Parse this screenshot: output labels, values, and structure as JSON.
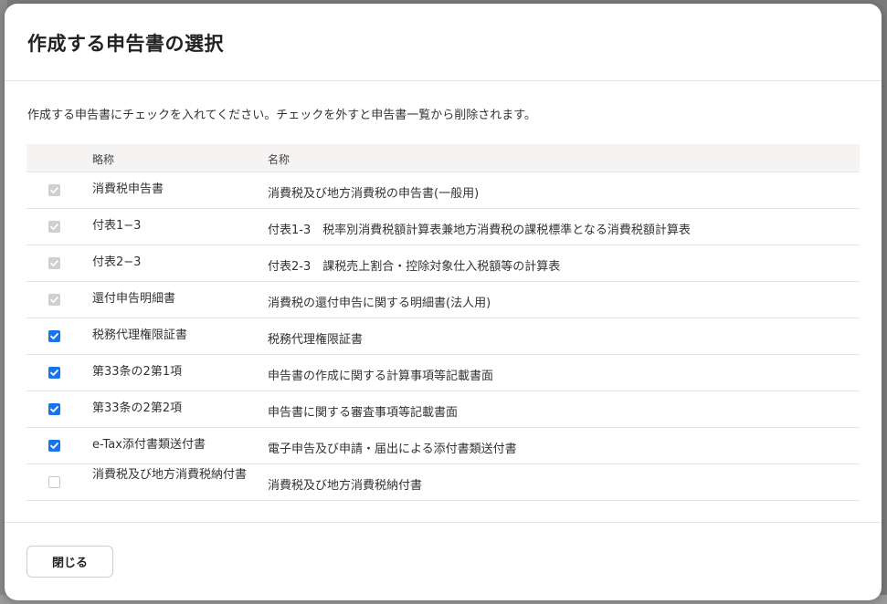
{
  "dialog": {
    "title": "作成する申告書の選択",
    "description": "作成する申告書にチェックを入れてください。チェックを外すと申告書一覧から削除されます。",
    "columns": {
      "abbr": "略称",
      "name": "名称"
    },
    "rows": [
      {
        "abbr": "消費税申告書",
        "name": "消費税及び地方消費税の申告書(一般用)",
        "state": "checked-disabled"
      },
      {
        "abbr": "付表1−3",
        "name": "付表1-3　税率別消費税額計算表兼地方消費税の課税標準となる消費税額計算表",
        "state": "checked-disabled"
      },
      {
        "abbr": "付表2−3",
        "name": "付表2-3　課税売上割合・控除対象仕入税額等の計算表",
        "state": "checked-disabled"
      },
      {
        "abbr": "還付申告明細書",
        "name": "消費税の還付申告に関する明細書(法人用)",
        "state": "checked-disabled"
      },
      {
        "abbr": "税務代理権限証書",
        "name": "税務代理権限証書",
        "state": "checked"
      },
      {
        "abbr": "第33条の2第1項",
        "name": "申告書の作成に関する計算事項等記載書面",
        "state": "checked"
      },
      {
        "abbr": "第33条の2第2項",
        "name": "申告書に関する審査事項等記載書面",
        "state": "checked"
      },
      {
        "abbr": "e-Tax添付書類送付書",
        "name": "電子申告及び申請・届出による添付書類送付書",
        "state": "checked"
      },
      {
        "abbr": "消費税及び地方消費税納付書",
        "name": "消費税及び地方消費税納付書",
        "state": "unchecked"
      }
    ],
    "close_label": "閉じる"
  },
  "colors": {
    "checkbox_checked": "#1a73e8",
    "checkbox_disabled": "#cfcfcf",
    "header_row_bg": "#f6f3f3"
  }
}
